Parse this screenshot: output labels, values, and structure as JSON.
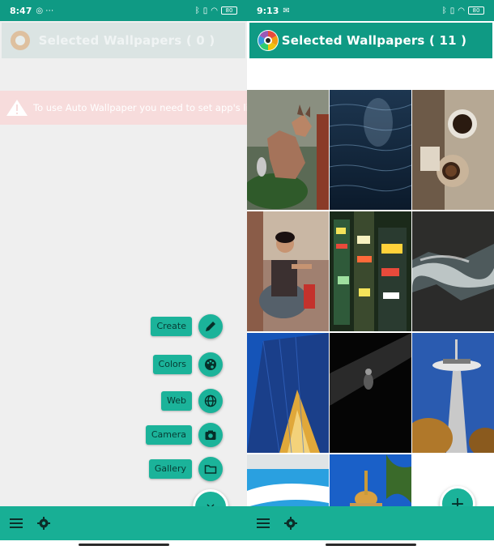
{
  "left_screen": {
    "status": {
      "time": "8:47",
      "extra": "◎ ⋯",
      "battery": "80"
    },
    "app_title": "Selected Wallpapers ( 0 )",
    "warning_text": "To use Auto Wallpaper you need to set app's live wallpaper. Click here to set now.",
    "fab_actions": [
      {
        "label": "Create",
        "icon": "pencil-icon"
      },
      {
        "label": "Colors",
        "icon": "palette-icon"
      },
      {
        "label": "Web",
        "icon": "globe-icon"
      },
      {
        "label": "Camera",
        "icon": "camera-icon"
      },
      {
        "label": "Gallery",
        "icon": "folder-icon"
      }
    ],
    "main_fab_symbol": "×"
  },
  "right_screen": {
    "status": {
      "time": "9:13",
      "extra": "✉",
      "battery": "80"
    },
    "app_title": "Selected Wallpapers ( 11 )",
    "main_fab_symbol": "+",
    "wallpapers": [
      "fox",
      "ocean",
      "coffee",
      "fashion",
      "city-night",
      "waves",
      "building",
      "dark-figure",
      "space-needle",
      "pool",
      "palace"
    ]
  },
  "colors": {
    "primary": "#0f9a84",
    "accent": "#1bb39a",
    "bottom_bar": "#18af95",
    "warning_bg": "#f7dcdc"
  }
}
